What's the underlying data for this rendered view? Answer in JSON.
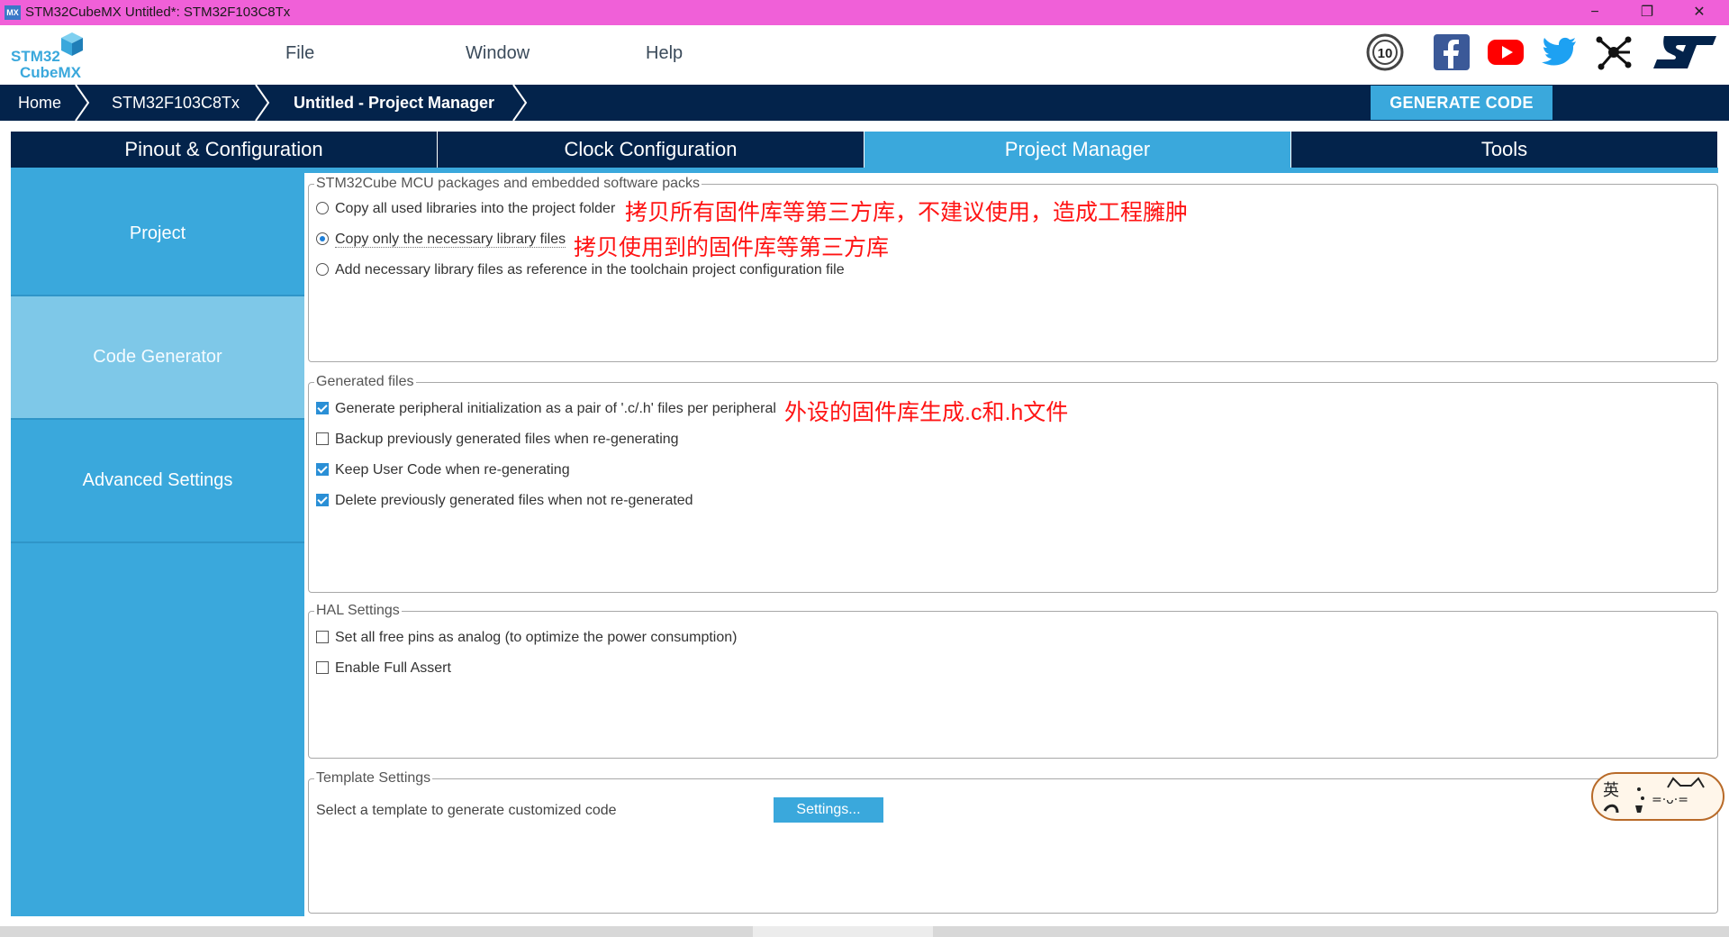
{
  "window": {
    "icon_text": "MX",
    "title": "STM32CubeMX Untitled*: STM32F103C8Tx",
    "minimize": "−",
    "maximize": "❐",
    "close": "✕"
  },
  "logo": {
    "line1": "STM32",
    "line2": "CubeMX"
  },
  "menu": {
    "file": "File",
    "window": "Window",
    "help": "Help"
  },
  "social": {
    "icons": [
      "anniversary-10-icon",
      "facebook-icon",
      "youtube-icon",
      "twitter-icon",
      "network-icon",
      "st-logo-icon"
    ],
    "colors": {
      "facebook": "#3b5998",
      "youtube": "#ff0000",
      "twitter": "#1da1f2",
      "st": "#03234b"
    }
  },
  "breadcrumb": {
    "home": "Home",
    "device": "STM32F103C8Tx",
    "current": "Untitled - Project Manager"
  },
  "generate_code": "GENERATE CODE",
  "tabs": {
    "pinout": "Pinout & Configuration",
    "clock": "Clock Configuration",
    "project_manager": "Project Manager",
    "tools": "Tools"
  },
  "sidebar": {
    "project": "Project",
    "code_generator": "Code Generator",
    "advanced": "Advanced Settings"
  },
  "mcu_packages": {
    "title": "STM32Cube MCU packages and embedded software packs",
    "opt1": "Copy all used libraries into the project folder",
    "opt2": "Copy only the necessary library files",
    "opt3": "Add necessary library files as reference in the toolchain project configuration file",
    "selected": 2,
    "note1": "拷贝所有固件库等第三方库，不建议使用，造成工程臃肿",
    "note2": "拷贝使用到的固件库等第三方库"
  },
  "generated_files": {
    "title": "Generated files",
    "opt1": "Generate peripheral initialization as a pair of '.c/.h' files per peripheral",
    "opt2": "Backup previously generated files when re-generating",
    "opt3": "Keep User Code when re-generating",
    "opt4": "Delete previously generated files when not re-generated",
    "checked": [
      true,
      false,
      true,
      true
    ],
    "note": "外设的固件库生成.c和.h文件"
  },
  "hal_settings": {
    "title": "HAL Settings",
    "opt1": "Set all free pins as analog (to optimize the power consumption)",
    "opt2": "Enable Full Assert",
    "checked": [
      false,
      false
    ]
  },
  "template_settings": {
    "title": "Template Settings",
    "label": "Select a template to generate customized code",
    "button": "Settings..."
  },
  "sticker": {
    "text": "英"
  },
  "colors": {
    "accent": "#3aa8dc",
    "navy": "#03234b",
    "titlebar": "#f060d8",
    "annotation": "#ff1414"
  }
}
